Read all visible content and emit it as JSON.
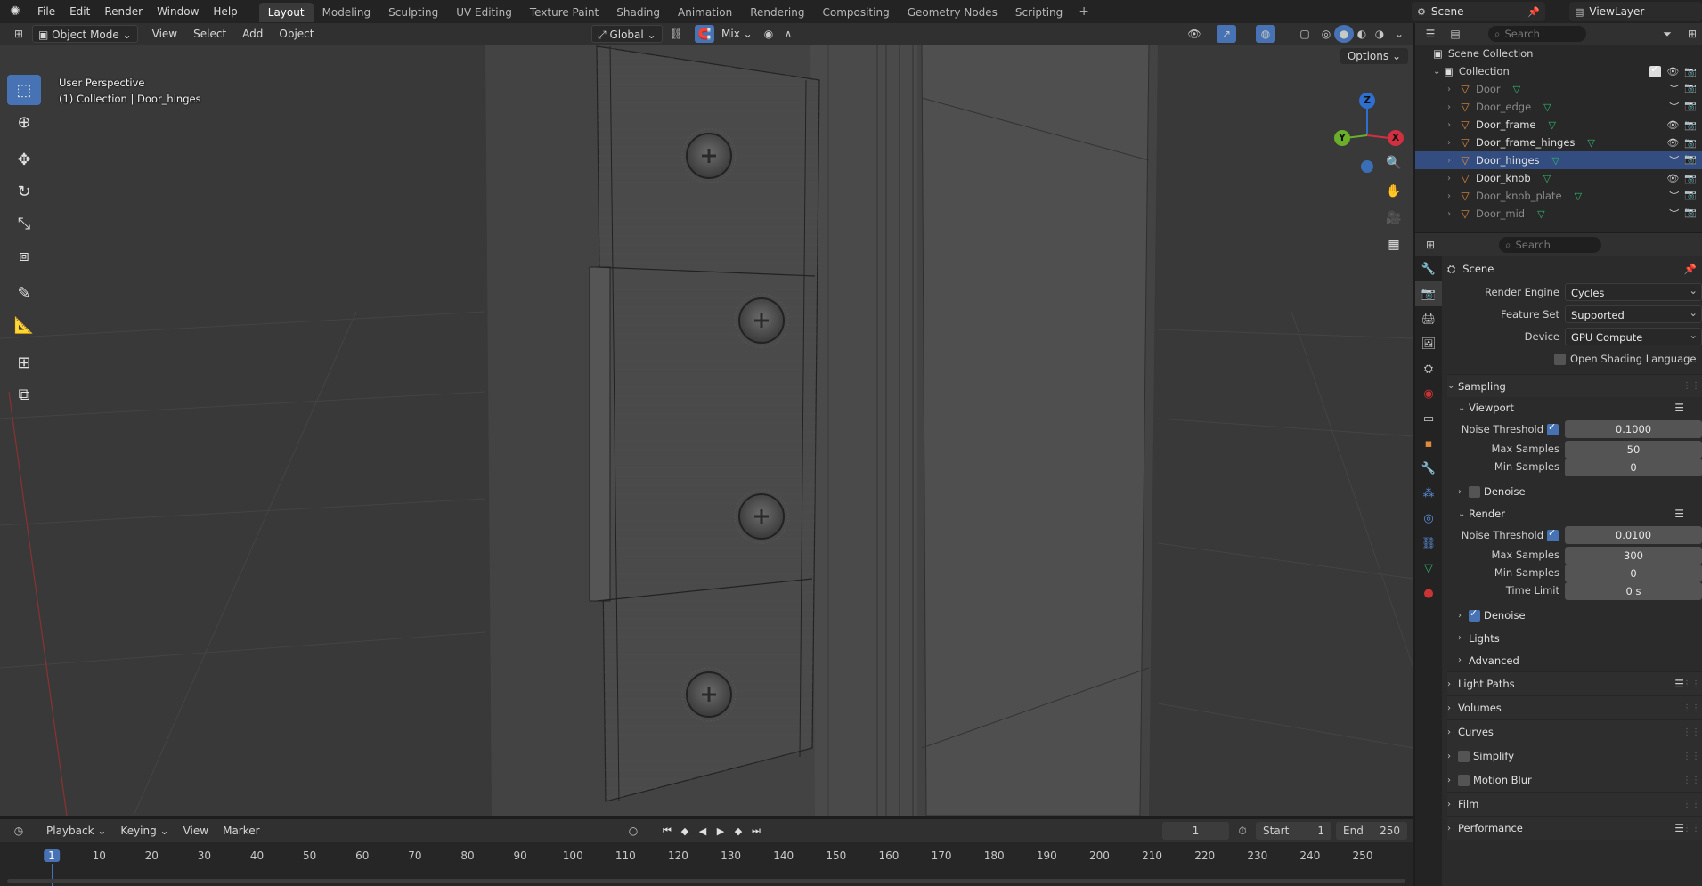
{
  "topbar": {
    "menus": [
      "File",
      "Edit",
      "Render",
      "Window",
      "Help"
    ],
    "workspaces": [
      "Layout",
      "Modeling",
      "Sculpting",
      "UV Editing",
      "Texture Paint",
      "Shading",
      "Animation",
      "Rendering",
      "Compositing",
      "Geometry Nodes",
      "Scripting"
    ],
    "active_workspace": "Layout",
    "add_icon": "+",
    "scene": "Scene",
    "view_layer": "ViewLayer"
  },
  "viewport_header": {
    "mode": "Object Mode",
    "menus": [
      "View",
      "Select",
      "Add",
      "Object"
    ],
    "orientation": "Global",
    "snap": "Mix",
    "options": "Options"
  },
  "viewport": {
    "perspective": "User Perspective",
    "collection_info": "(1) Collection | Door_hinges",
    "gizmo": {
      "x": "X",
      "y": "Y",
      "z": "Z"
    }
  },
  "timeline": {
    "menus": [
      "Playback",
      "Keying",
      "View",
      "Marker"
    ],
    "current_frame": "1",
    "start_label": "Start",
    "start": "1",
    "end_label": "End",
    "end": "250",
    "ticks": [
      "1",
      "10",
      "20",
      "30",
      "40",
      "50",
      "60",
      "70",
      "80",
      "90",
      "100",
      "110",
      "120",
      "130",
      "140",
      "150",
      "160",
      "170",
      "180",
      "190",
      "200",
      "210",
      "220",
      "230",
      "240",
      "250"
    ]
  },
  "outliner": {
    "search_placeholder": "Search",
    "scene_collection": "Scene Collection",
    "collection": "Collection",
    "objects": [
      {
        "name": "Door",
        "selected": false,
        "visible": false
      },
      {
        "name": "Door_edge",
        "selected": false,
        "visible": false
      },
      {
        "name": "Door_frame",
        "selected": false,
        "visible": true
      },
      {
        "name": "Door_frame_hinges",
        "selected": false,
        "visible": true
      },
      {
        "name": "Door_hinges",
        "selected": true,
        "visible": false
      },
      {
        "name": "Door_knob",
        "selected": false,
        "visible": true
      },
      {
        "name": "Door_knob_plate",
        "selected": false,
        "visible": false
      },
      {
        "name": "Door_mid",
        "selected": false,
        "visible": false
      }
    ]
  },
  "properties": {
    "search_placeholder": "Search",
    "context": "Scene",
    "render_engine_label": "Render Engine",
    "render_engine": "Cycles",
    "feature_set_label": "Feature Set",
    "feature_set": "Supported",
    "device_label": "Device",
    "device": "GPU Compute",
    "osl_label": "Open Shading Language",
    "sampling": "Sampling",
    "viewport": "Viewport",
    "noise_threshold_label": "Noise Threshold",
    "vp_noise_threshold": "0.1000",
    "max_samples_label": "Max Samples",
    "vp_max_samples": "50",
    "min_samples_label": "Min Samples",
    "vp_min_samples": "0",
    "denoise_label": "Denoise",
    "render": "Render",
    "r_noise_threshold": "0.0100",
    "r_max_samples": "300",
    "r_min_samples": "0",
    "time_limit_label": "Time Limit",
    "time_limit": "0 s",
    "lights": "Lights",
    "advanced": "Advanced",
    "light_paths": "Light Paths",
    "volumes": "Volumes",
    "curves": "Curves",
    "simplify": "Simplify",
    "motion_blur": "Motion Blur",
    "film": "Film",
    "performance": "Performance"
  },
  "colors": {
    "accent": "#4772b3",
    "selection": "#334d80",
    "mesh_icon": "#e08a3c",
    "data_icon": "#30b870"
  }
}
